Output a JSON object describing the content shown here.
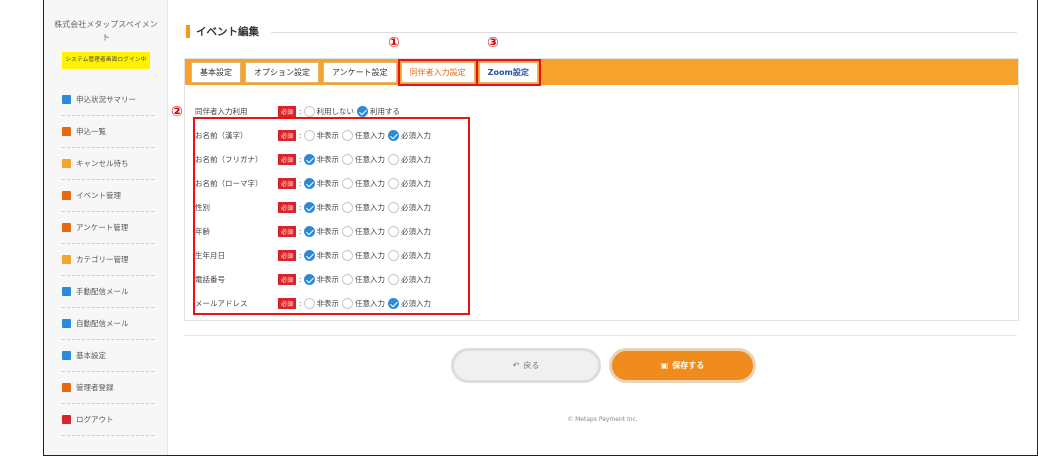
{
  "sidebar": {
    "company_name": "株式会社メタップスペイメント",
    "login_badge": "システム管理者画面ログイン中",
    "items": [
      {
        "label": "申込状況サマリー",
        "icon": "chart-icon",
        "color": "#2e8ad8"
      },
      {
        "label": "申込一覧",
        "icon": "book-icon",
        "color": "#e36a10"
      },
      {
        "label": "キャンセル待ち",
        "icon": "clock-icon",
        "color": "#f5a32d"
      },
      {
        "label": "イベント管理",
        "icon": "grid-icon",
        "color": "#e36a10"
      },
      {
        "label": "アンケート管理",
        "icon": "pie-icon",
        "color": "#e36a10"
      },
      {
        "label": "カテゴリー管理",
        "icon": "list-icon",
        "color": "#f5a32d"
      },
      {
        "label": "手動配信メール",
        "icon": "rss-icon",
        "color": "#2e8ad8"
      },
      {
        "label": "自動配信メール",
        "icon": "mail-icon",
        "color": "#2e8ad8"
      },
      {
        "label": "基本設定",
        "icon": "gear-icon",
        "color": "#2e8ad8"
      },
      {
        "label": "管理者登録",
        "icon": "users-icon",
        "color": "#e36a10"
      },
      {
        "label": "ログアウト",
        "icon": "logout-icon",
        "color": "#d9232a"
      }
    ]
  },
  "main": {
    "title": "イベント編集",
    "tabs": [
      {
        "label": "基本設定"
      },
      {
        "label": "オプション設定"
      },
      {
        "label": "アンケート設定"
      },
      {
        "label": "同伴者入力設定"
      },
      {
        "label": "Zoom設定"
      }
    ],
    "required_badge": "必須",
    "companion": {
      "label": "同伴者入力利用",
      "options": [
        "利用しない",
        "利用する"
      ],
      "selected": 1
    },
    "field_options": [
      "非表示",
      "任意入力",
      "必須入力"
    ],
    "fields": [
      {
        "label": "お名前（漢字）",
        "selected": 2
      },
      {
        "label": "お名前（フリガナ）",
        "selected": 0
      },
      {
        "label": "お名前（ローマ字）",
        "selected": 0
      },
      {
        "label": "性別",
        "selected": 0
      },
      {
        "label": "年齢",
        "selected": 0
      },
      {
        "label": "生年月日",
        "selected": 0
      },
      {
        "label": "電話番号",
        "selected": 0
      },
      {
        "label": "メールアドレス",
        "selected": 2
      }
    ],
    "back_button": "戻る",
    "save_button": "保存する",
    "copyright": "© Metaps Payment Inc."
  },
  "annotations": {
    "mark1": "①",
    "mark2": "②",
    "mark3": "③"
  },
  "colors": {
    "accent": "#f5a32d",
    "checked": "#2e8ad8",
    "required": "#d9232a",
    "annotation": "#e11111"
  }
}
